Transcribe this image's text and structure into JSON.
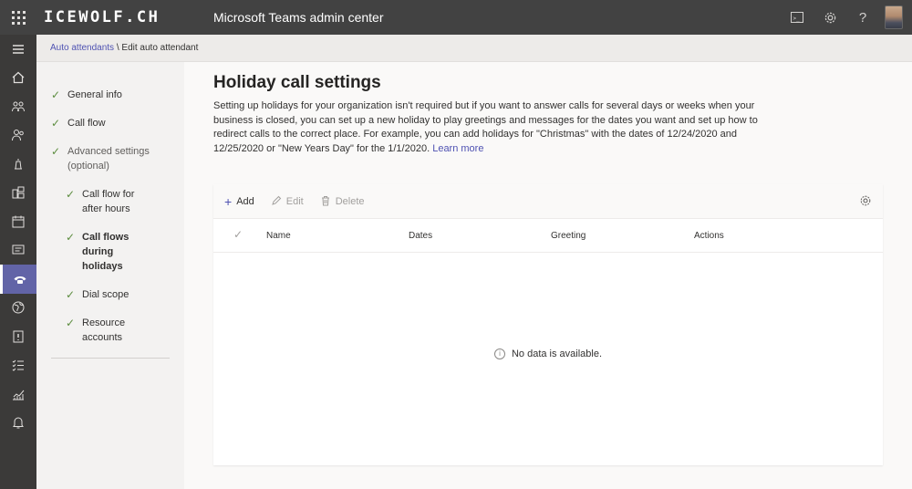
{
  "topbar": {
    "brand": "ICEWOLF.CH",
    "app_title": "Microsoft Teams admin center",
    "icons": [
      "waffle-icon",
      "cloud-shell-icon",
      "gear-icon",
      "help-icon",
      "avatar"
    ]
  },
  "rail": {
    "items": [
      "menu-icon",
      "home-icon",
      "teams-icon",
      "users-icon",
      "devices-icon",
      "locations-icon",
      "meetings-icon",
      "messaging-icon",
      "voice-icon",
      "policy-packages-icon",
      "planning-icon",
      "analytics-icon",
      "call-quality-icon",
      "notifications-icon"
    ],
    "active": "voice-icon"
  },
  "breadcrumb": {
    "link": "Auto attendants",
    "separator": " \\ ",
    "current": "Edit auto attendant"
  },
  "steps": [
    {
      "label": "General info"
    },
    {
      "label": "Call flow"
    },
    {
      "label": "Advanced settings (optional)"
    },
    {
      "label": "Call flow for after hours"
    },
    {
      "label": "Call flows during holidays"
    },
    {
      "label": "Dial scope"
    },
    {
      "label": "Resource accounts"
    }
  ],
  "main": {
    "title": "Holiday call settings",
    "description": "Setting up holidays for your organization isn't required but if you want to answer calls for several days or weeks when your business is closed, you can set up a new holiday to play greetings and messages for the dates you want and set up how to redirect calls to the correct place. For example, you can add holidays for \"Christmas\" with the dates of 12/24/2020 and 12/25/2020 or \"New Years Day\" for the 1/1/2020.",
    "learn_more": "Learn more"
  },
  "toolbar": {
    "add": "Add",
    "edit": "Edit",
    "delete": "Delete"
  },
  "table": {
    "columns": [
      "Name",
      "Dates",
      "Greeting",
      "Actions"
    ],
    "empty_message": "No data is available."
  },
  "colors": {
    "topbar": "#424242",
    "rail": "#3b3a39",
    "accent": "#6264a7",
    "link": "#4f52b2",
    "check": "#5c8d3f"
  }
}
